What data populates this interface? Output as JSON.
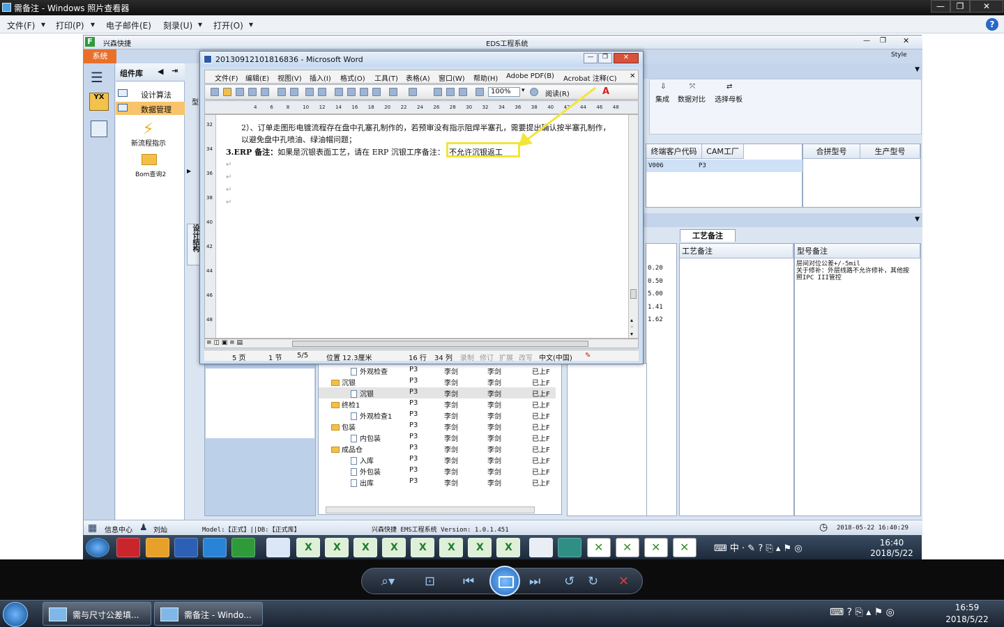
{
  "viewer": {
    "title": "需备注 - Windows 照片查看器",
    "menu": [
      "文件(F)",
      "打印(P)",
      "电子邮件(E)",
      "刻录(U)",
      "打开(O)"
    ]
  },
  "eds": {
    "title": "EDS工程系统",
    "brand": "兴森快捷",
    "system_tab": "系统",
    "style_label": "Style",
    "component_lib": "组件库",
    "components": [
      "设计算法",
      "数据管理",
      "新流程指示",
      "Bom查询2"
    ],
    "vertical_tab": "设计结构",
    "ribbon": [
      "集成",
      "数据对比",
      "选择母板"
    ],
    "ribbon_prefix": "型",
    "top_grid": {
      "headers": [
        "终端客户代码",
        "CAM工厂"
      ],
      "row": [
        "V006",
        "P3"
      ]
    },
    "top_grid2": {
      "headers": [
        "合拼型号",
        "生产型号"
      ]
    },
    "process_tab": "工艺备注",
    "lower_headers": [
      "工艺备注",
      "型号备注"
    ],
    "left_values": [
      "0.20",
      "0.50",
      "5.00",
      "1.41",
      "1.62"
    ],
    "model_note": "层间对位公差+/-5mil\n关于修补：外层线路不允许修补，其他按照IPC III管控",
    "tree": [
      {
        "indent": 2,
        "kind": "doc",
        "name": "外观检查",
        "factory": "P3",
        "user1": "李剑",
        "user2": "李剑",
        "status": "已上F"
      },
      {
        "indent": 1,
        "kind": "folder",
        "name": "沉银",
        "factory": "P3",
        "user1": "李剑",
        "user2": "李剑",
        "status": "已上F"
      },
      {
        "indent": 2,
        "kind": "doc",
        "name": "沉银",
        "factory": "P3",
        "user1": "李剑",
        "user2": "李剑",
        "status": "已上F",
        "selected": true
      },
      {
        "indent": 1,
        "kind": "folder",
        "name": "终检1",
        "factory": "P3",
        "user1": "李剑",
        "user2": "李剑",
        "status": "已上F"
      },
      {
        "indent": 2,
        "kind": "doc",
        "name": "外观检查1",
        "factory": "P3",
        "user1": "李剑",
        "user2": "李剑",
        "status": "已上F"
      },
      {
        "indent": 1,
        "kind": "folder",
        "name": "包装",
        "factory": "P3",
        "user1": "李剑",
        "user2": "李剑",
        "status": "已上F"
      },
      {
        "indent": 2,
        "kind": "doc",
        "name": "内包装",
        "factory": "P3",
        "user1": "李剑",
        "user2": "李剑",
        "status": "已上F"
      },
      {
        "indent": 1,
        "kind": "folder",
        "name": "成品仓",
        "factory": "P3",
        "user1": "李剑",
        "user2": "李剑",
        "status": "已上F"
      },
      {
        "indent": 2,
        "kind": "doc",
        "name": "入库",
        "factory": "P3",
        "user1": "李剑",
        "user2": "李剑",
        "status": "已上F"
      },
      {
        "indent": 2,
        "kind": "doc",
        "name": "外包装",
        "factory": "P3",
        "user1": "李剑",
        "user2": "李剑",
        "status": "已上F"
      },
      {
        "indent": 2,
        "kind": "doc",
        "name": "出库",
        "factory": "P3",
        "user1": "李剑",
        "user2": "李剑",
        "status": "已上F"
      }
    ],
    "status": {
      "info_center": "信息中心",
      "user": "刘灿",
      "model": "Model:【正式】||DB:【正式库】",
      "version": "兴森快捷 EMS工程系统 Version: 1.0.1.451",
      "datetime": "2018-05-22 16:40:29"
    }
  },
  "inner_clock": {
    "time": "16:40",
    "date": "2018/5/22"
  },
  "word": {
    "title": "20130912101816836 - Microsoft Word",
    "menu": [
      "文件(F)",
      "编辑(E)",
      "视图(V)",
      "插入(I)",
      "格式(O)",
      "工具(T)",
      "表格(A)",
      "窗口(W)",
      "帮助(H)",
      "Adobe PDF(B)",
      "Acrobat 注释(C)"
    ],
    "zoom": "100%",
    "read_button": "阅读(R)",
    "ruler_ticks": [
      "4",
      "6",
      "8",
      "10",
      "12",
      "14",
      "16",
      "18",
      "20",
      "22",
      "24",
      "26",
      "28",
      "30",
      "32",
      "34",
      "36",
      "38",
      "40",
      "42",
      "44",
      "46",
      "48"
    ],
    "vruler_ticks": [
      "32",
      "34",
      "36",
      "38",
      "40",
      "42",
      "44",
      "46",
      "48"
    ],
    "doc_lines": {
      "line1": "2）、订单走图形电镀流程存在盘中孔塞孔制作的，若预审没有指示阻焊半塞孔，需要提出确认按半塞孔制作，",
      "line2": "以避免盘中孔喷油、绿油帽问题；",
      "line3_label": "3.ERP 备注：",
      "line3_text": "如果是沉银表面工艺，请在 ERP 沉银工序备注：",
      "highlight": "不允许沉银返工"
    },
    "status": {
      "page": "5 页",
      "section": "1 节",
      "of": "5/5",
      "position": "位置 12.3厘米",
      "line": "16 行",
      "col": "34 列",
      "rec": "录制",
      "trk": "修订",
      "ext": "扩展",
      "ovr": "改写",
      "lang": "中文(中国)"
    }
  },
  "taskbar": {
    "items": [
      "需与尺寸公差填...",
      "需备注 - Windo..."
    ],
    "time": "16:59",
    "date": "2018/5/22"
  },
  "colors": {
    "accent": "#e8702a",
    "highlight": "#f2e53a",
    "selection": "#f7c46b"
  }
}
